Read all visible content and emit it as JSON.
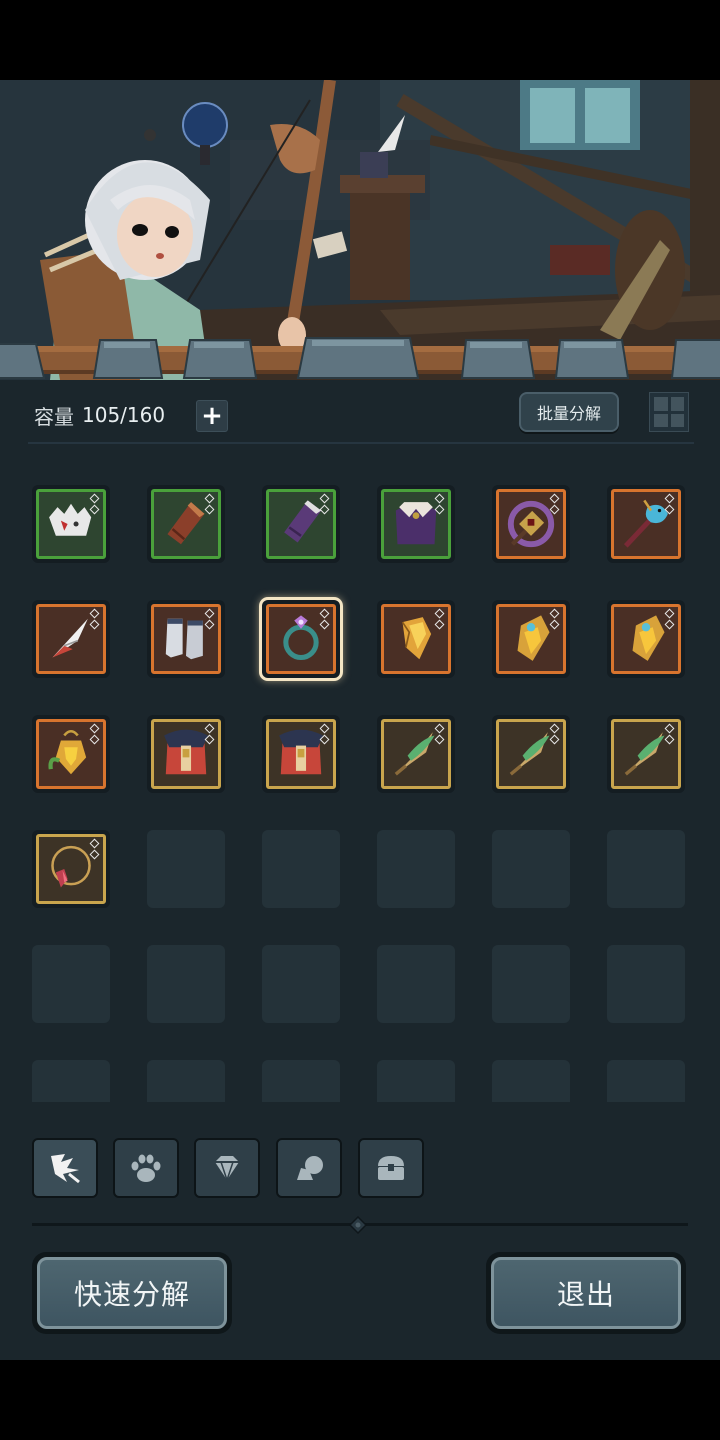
{
  "inventory": {
    "capacity_label": "容量",
    "capacity_value": "105/160",
    "add_symbol": "+",
    "batch_button_label": "批量分解",
    "items": [
      {
        "rarity": "green",
        "icon": "white-spiky-armor-icon"
      },
      {
        "rarity": "green",
        "icon": "leather-bracer-icon"
      },
      {
        "rarity": "green",
        "icon": "purple-gauntlet-icon"
      },
      {
        "rarity": "green",
        "icon": "purple-cape-icon"
      },
      {
        "rarity": "orange",
        "icon": "spiked-mace-icon"
      },
      {
        "rarity": "orange",
        "icon": "bird-staff-icon"
      },
      {
        "rarity": "orange",
        "icon": "feather-dagger-icon"
      },
      {
        "rarity": "orange",
        "icon": "white-boots-icon"
      },
      {
        "rarity": "orange",
        "icon": "gem-ring-icon",
        "selected": true
      },
      {
        "rarity": "orange",
        "icon": "gold-crystal-icon"
      },
      {
        "rarity": "orange",
        "icon": "gold-bracer-icon"
      },
      {
        "rarity": "orange",
        "icon": "gold-bracer-icon"
      },
      {
        "rarity": "orange",
        "icon": "gold-amulet-icon"
      },
      {
        "rarity": "gold",
        "icon": "fur-chest-armor-icon"
      },
      {
        "rarity": "gold",
        "icon": "fur-chest-armor-icon"
      },
      {
        "rarity": "gold",
        "icon": "leaf-blade-icon"
      },
      {
        "rarity": "gold",
        "icon": "leaf-blade-icon"
      },
      {
        "rarity": "gold",
        "icon": "leaf-blade-icon"
      },
      {
        "rarity": "gold",
        "icon": "ruby-necklace-icon"
      }
    ],
    "empty_slots": 17
  },
  "tabs": [
    {
      "icon": "weapon-tab-icon",
      "active": true
    },
    {
      "icon": "paw-tab-icon",
      "active": false
    },
    {
      "icon": "gem-tab-icon",
      "active": false
    },
    {
      "icon": "material-tab-icon",
      "active": false
    },
    {
      "icon": "chest-tab-icon",
      "active": false
    }
  ],
  "actions": {
    "quick_decompose_label": "快速分解",
    "exit_label": "退出"
  },
  "colors": {
    "panel_bg": "#1b262c",
    "rarity_green": "#4aa13b",
    "rarity_orange": "#d8742e",
    "rarity_gold": "#c9a54d",
    "button_face": "#4e6670"
  }
}
